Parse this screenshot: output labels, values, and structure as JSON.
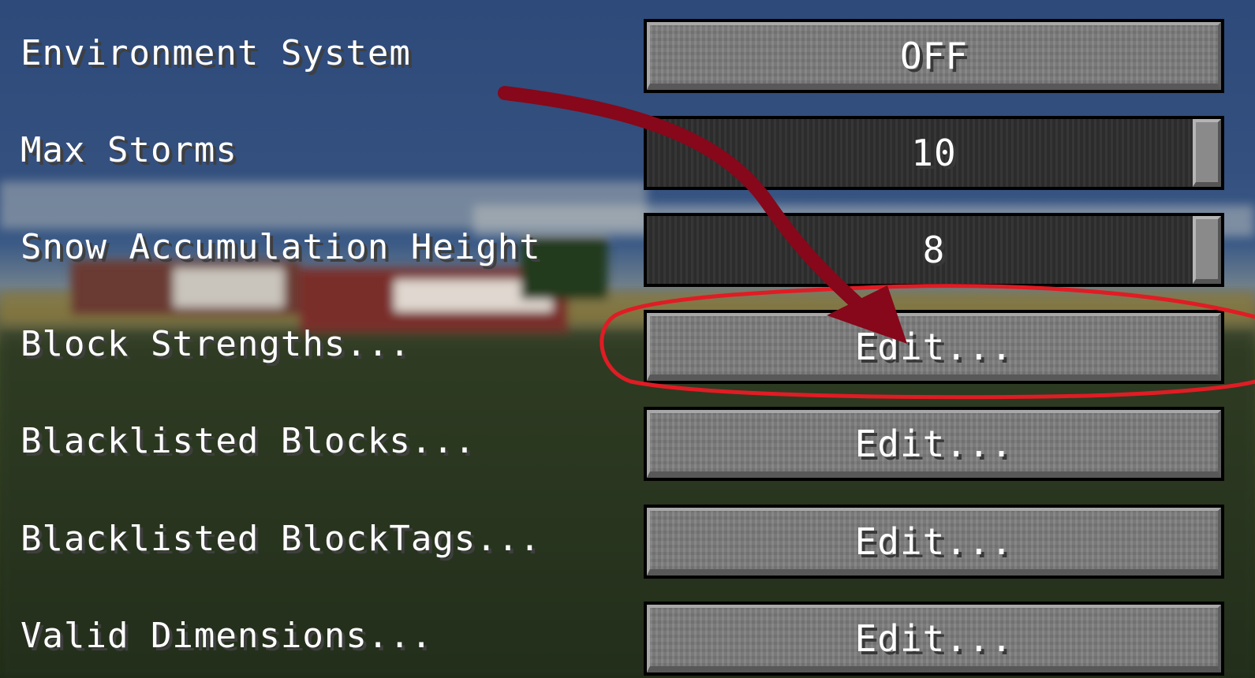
{
  "settings": [
    {
      "label": "Environment System",
      "control": "toggle",
      "value": "OFF"
    },
    {
      "label": "Max Storms",
      "control": "slider",
      "value": "10",
      "level": 1.0
    },
    {
      "label": "Snow Accumulation Height",
      "control": "slider",
      "value": "8",
      "level": 1.0
    },
    {
      "label": "Block Strengths...",
      "control": "button",
      "value": "Edit..."
    },
    {
      "label": "Blacklisted Blocks...",
      "control": "button",
      "value": "Edit..."
    },
    {
      "label": "Blacklisted BlockTags...",
      "control": "button",
      "value": "Edit..."
    },
    {
      "label": "Valid Dimensions...",
      "control": "button",
      "value": "Edit..."
    }
  ],
  "annotations": {
    "circle_color": "#e01c24",
    "arrow_color": "#86081a"
  }
}
